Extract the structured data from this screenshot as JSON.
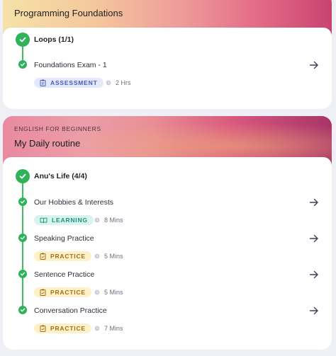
{
  "course1": {
    "title": "Programming Foundations",
    "section": "Loops (1/1)",
    "items": [
      {
        "title": "Foundations Exam - 1",
        "badge": "ASSESSMENT",
        "duration": "2 Hrs"
      }
    ]
  },
  "course2": {
    "eyebrow": "ENGLISH FOR BEGINNERS",
    "title": "My Daily routine",
    "section": "Anu's Life (4/4)",
    "items": [
      {
        "title": "Our Hobbies & Interests",
        "badge": "LEARNING",
        "duration": "8 Mins"
      },
      {
        "title": "Speaking Practice",
        "badge": "PRACTICE",
        "duration": "5 Mins"
      },
      {
        "title": "Sentence Practice",
        "badge": "PRACTICE",
        "duration": "5 Mins"
      },
      {
        "title": "Conversation Practice",
        "badge": "PRACTICE",
        "duration": "7 Mins"
      }
    ]
  },
  "colors": {
    "check_green": "#2fb35a",
    "assessment_badge": "#e4e8fb",
    "learning_badge": "#d7f5ee",
    "practice_badge": "#fdf1c9"
  }
}
